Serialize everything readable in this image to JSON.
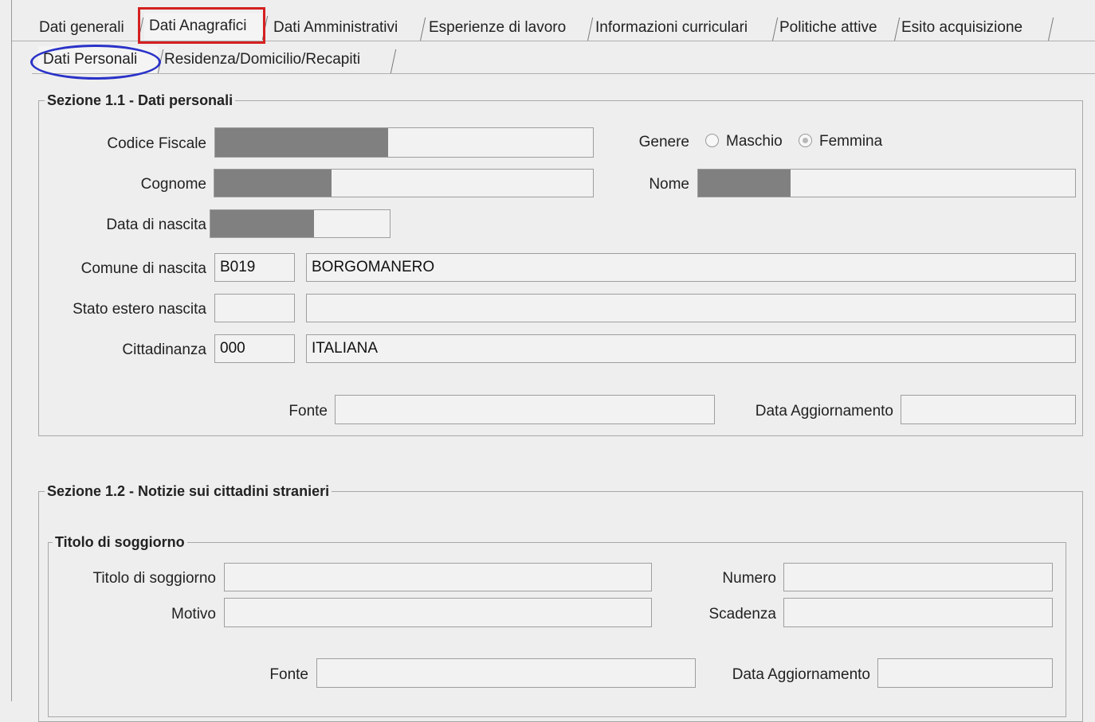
{
  "main_tabs": [
    {
      "label": "Dati generali"
    },
    {
      "label": "Dati Anagrafici",
      "active": true
    },
    {
      "label": "Dati Amministrativi"
    },
    {
      "label": "Esperienze di lavoro"
    },
    {
      "label": "Informazioni curriculari"
    },
    {
      "label": "Politiche attive"
    },
    {
      "label": "Esito acquisizione"
    }
  ],
  "sub_tabs": [
    {
      "label": "Dati Personali",
      "active": true
    },
    {
      "label": "Residenza/Domicilio/Recapiti"
    }
  ],
  "section1": {
    "title": "Sezione 1.1 - Dati personali",
    "codice_fiscale": {
      "label": "Codice Fiscale",
      "value": ""
    },
    "genere": {
      "label": "Genere",
      "options": [
        "Maschio",
        "Femmina"
      ],
      "selected": "Femmina"
    },
    "cognome": {
      "label": "Cognome",
      "value": ""
    },
    "nome": {
      "label": "Nome",
      "value": ""
    },
    "data_nascita": {
      "label": "Data di nascita",
      "value": ""
    },
    "comune_nascita": {
      "label": "Comune di nascita",
      "code": "B019",
      "name": "BORGOMANERO"
    },
    "stato_estero": {
      "label": "Stato estero nascita",
      "code": "",
      "name": ""
    },
    "cittadinanza": {
      "label": "Cittadinanza",
      "code": "000",
      "name": "ITALIANA"
    },
    "fonte": {
      "label": "Fonte",
      "value": ""
    },
    "data_aggiornamento": {
      "label": "Data Aggiornamento",
      "value": ""
    }
  },
  "section2": {
    "title": "Sezione 1.2 - Notizie sui cittadini stranieri",
    "subsection_title": "Titolo di soggiorno",
    "titolo": {
      "label": "Titolo di soggiorno",
      "value": ""
    },
    "numero": {
      "label": "Numero",
      "value": ""
    },
    "motivo": {
      "label": "Motivo",
      "value": ""
    },
    "scadenza": {
      "label": "Scadenza",
      "value": ""
    },
    "fonte": {
      "label": "Fonte",
      "value": ""
    },
    "data_aggiornamento": {
      "label": "Data Aggiornamento",
      "value": ""
    }
  },
  "colors": {
    "highlight_red": "#d42020",
    "highlight_blue": "#2a32c8",
    "redaction": "#808080"
  }
}
